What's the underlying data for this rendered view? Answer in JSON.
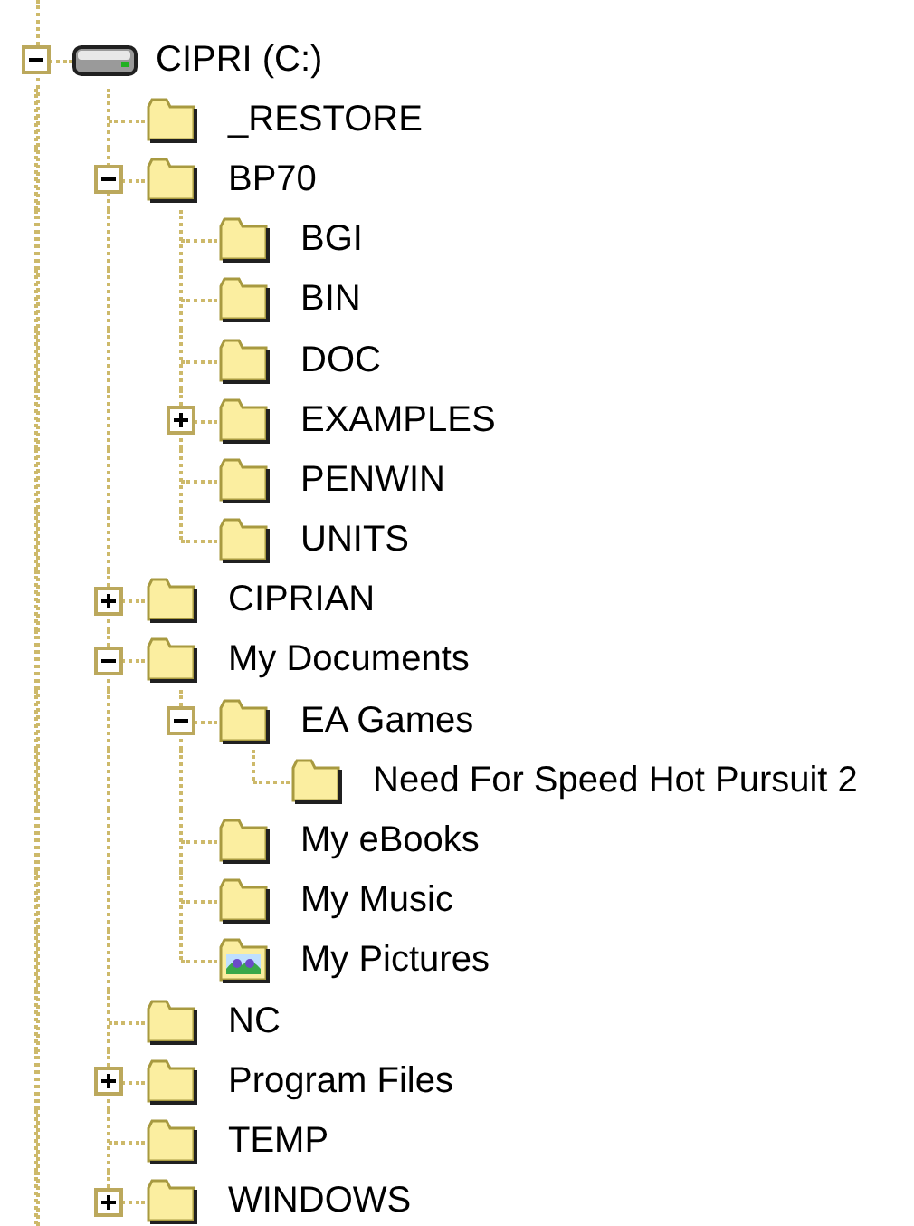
{
  "tree": [
    {
      "label": "CIPRI (C:)",
      "kind": "drive",
      "expanded": true,
      "children": [
        {
          "label": "_RESTORE",
          "kind": "folder"
        },
        {
          "label": "BP70",
          "kind": "folder",
          "expanded": true,
          "children": [
            {
              "label": "BGI",
              "kind": "folder"
            },
            {
              "label": "BIN",
              "kind": "folder"
            },
            {
              "label": "DOC",
              "kind": "folder"
            },
            {
              "label": "EXAMPLES",
              "kind": "folder",
              "expanded": false
            },
            {
              "label": "PENWIN",
              "kind": "folder"
            },
            {
              "label": "UNITS",
              "kind": "folder"
            }
          ]
        },
        {
          "label": "CIPRIAN",
          "kind": "folder",
          "expanded": false
        },
        {
          "label": "My Documents",
          "kind": "folder",
          "expanded": true,
          "children": [
            {
              "label": "EA Games",
              "kind": "folder",
              "expanded": true,
              "children": [
                {
                  "label": "Need For Speed Hot Pursuit 2",
                  "kind": "folder"
                }
              ]
            },
            {
              "label": "My eBooks",
              "kind": "folder"
            },
            {
              "label": "My Music",
              "kind": "folder"
            },
            {
              "label": "My Pictures",
              "kind": "pictures-folder"
            }
          ]
        },
        {
          "label": "NC",
          "kind": "folder"
        },
        {
          "label": "Program Files",
          "kind": "folder",
          "expanded": false
        },
        {
          "label": "TEMP",
          "kind": "folder"
        },
        {
          "label": "WINDOWS",
          "kind": "folder",
          "expanded": false
        }
      ]
    }
  ]
}
